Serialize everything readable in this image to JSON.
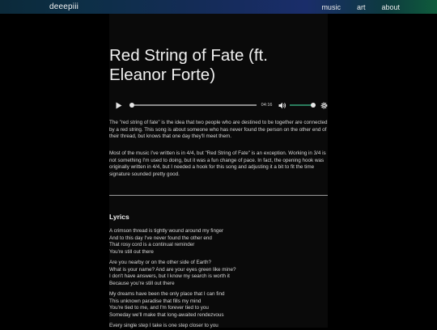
{
  "nav": {
    "brand": "deeepiii",
    "links": [
      "music",
      "art",
      "about"
    ]
  },
  "page": {
    "title": "Red String of Fate (ft. Eleanor Forte)"
  },
  "player": {
    "time": "04:16",
    "progress": 0,
    "volume": 1.0,
    "accent": "#2a7d5d"
  },
  "description": [
    "The \"red string of fate\" is the idea that two people who are destined to be together are connected by a red string. This song is about someone who has never found the person on the other end of their thread, but knows that one day they'll meet them.",
    "Most of the music I've written is in 4/4, but \"Red String of Fate\" is an exception. Working in 3/4 is not something I'm used to doing, but it was a fun change of pace. In fact, the opening hook was originally written in 4/4, but I needed a hook for this song and adjusting it a bit to fit the time signature sounded pretty good."
  ],
  "lyrics": {
    "heading": "Lyrics",
    "stanzas": [
      [
        "A crimson thread is tightly wound around my finger",
        "And to this day I've never found the other end",
        "That rosy cord is a continual reminder",
        "You're still out there"
      ],
      [
        "Are you nearby or on the other side of Earth?",
        "What is your name? And are your eyes green like mine?",
        "I don't have answers, but I know my search is worth it",
        "Because you're still out there"
      ],
      [
        "My dreams have been the only place that I can find",
        "This unknown paradise that fills my mind",
        "You're tied to me, and I'm forever tied to you",
        "Someday we'll make that long-awaited rendezvous"
      ],
      [
        "Every single step I take is one step closer to you"
      ]
    ]
  }
}
